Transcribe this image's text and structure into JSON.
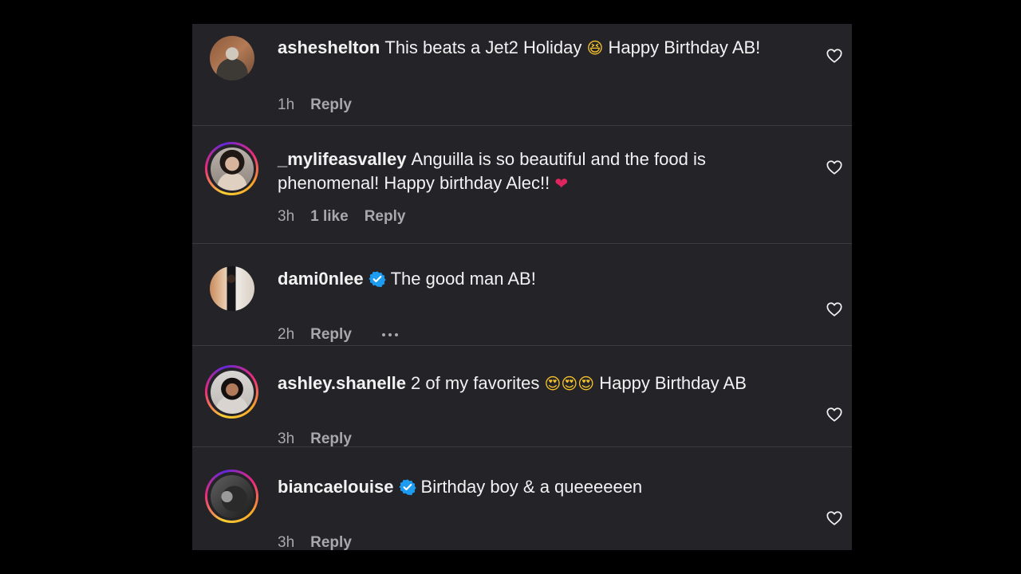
{
  "comments": [
    {
      "username": "asheshelton",
      "text_before": "This beats a Jet2 Holiday",
      "emoji": "😆",
      "text_after": "Happy Birthday AB!",
      "time": "1h",
      "reply_label": "Reply",
      "verified": false,
      "ring": false
    },
    {
      "username": "_mylifeasvalley",
      "text_before": "Anguilla is so beautiful and the food is phenomenal! Happy birthday Alec!!",
      "emoji": "❤",
      "text_after": "",
      "time": "3h",
      "likes": "1 like",
      "reply_label": "Reply",
      "verified": false,
      "ring": true
    },
    {
      "username": "dami0nlee",
      "text_before": "The good man AB!",
      "time": "2h",
      "reply_label": "Reply",
      "verified": true,
      "ring": false,
      "more": "more-options"
    },
    {
      "username": "ashley.shanelle",
      "text_before": "2 of my favorites",
      "emoji": "😍😍😍",
      "text_after": "Happy Birthday AB",
      "time": "3h",
      "reply_label": "Reply",
      "verified": false,
      "ring": true
    },
    {
      "username": "biancaelouise",
      "text_before": "Birthday boy & a queeeeeen",
      "time": "3h",
      "reply_label": "Reply",
      "verified": true,
      "ring": true
    }
  ],
  "colors": {
    "background": "#000000",
    "panel": "#232328",
    "text": "#f2f2f2",
    "meta": "#a8a8ad",
    "verified": "#1d9bf0"
  },
  "icons": {
    "like": "heart-outline-icon",
    "verified": "verified-badge-icon",
    "more": "ellipsis-icon"
  }
}
